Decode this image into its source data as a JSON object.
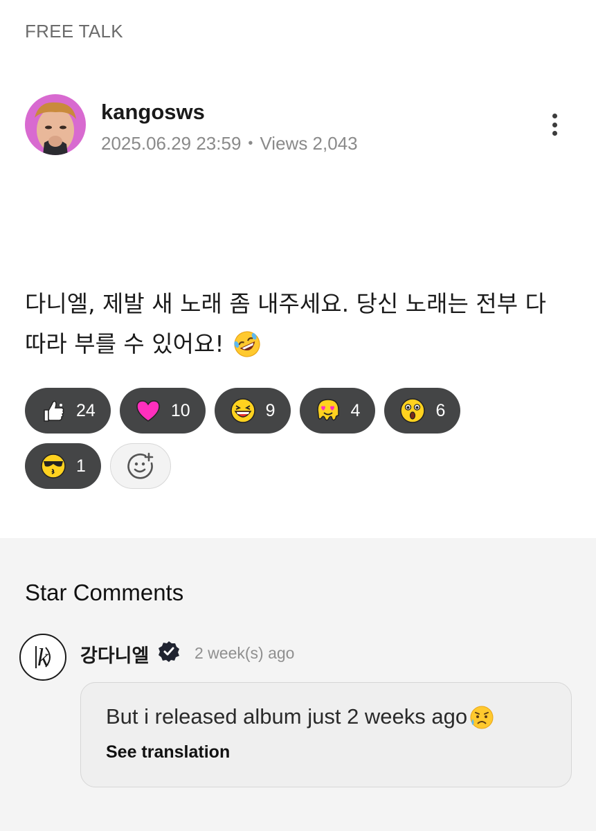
{
  "board": {
    "category": "FREE TALK"
  },
  "post": {
    "author": "kangosws",
    "date": "2025.06.29 23:59",
    "separator": "•",
    "views": "Views 2,043",
    "body_line1": "다니엘, 제발 새 노래 좀 내주세요. 당신 노래는 전부 다",
    "body_line2": "따라 부를 수 있어요!",
    "body_emoji_icon": "rolling-on-floor-laughing-icon"
  },
  "reactions": [
    {
      "icon": "thumbs-up-icon",
      "count": "24"
    },
    {
      "icon": "heart-icon",
      "count": "10"
    },
    {
      "icon": "laughing-face-icon",
      "count": "9"
    },
    {
      "icon": "melting-heart-eyes-icon",
      "count": "4"
    },
    {
      "icon": "surprised-face-icon",
      "count": "6"
    },
    {
      "icon": "sunglasses-kiss-icon",
      "count": "1"
    }
  ],
  "add_reaction_icon": "add-reaction-icon",
  "star_comments": {
    "title": "Star Comments",
    "comment": {
      "author": "강다니엘",
      "verified_icon": "verified-badge-icon",
      "time": "2 week(s) ago",
      "text": "But i released album just 2 weeks ago",
      "text_emoji_icon": "sad-sweat-face-icon",
      "translate_label": "See translation"
    }
  },
  "colors": {
    "chip_bg": "#444546",
    "heart": "#ff2fbd",
    "emoji_yellow": "#ffd21f",
    "comments_bg": "#f4f4f4"
  }
}
